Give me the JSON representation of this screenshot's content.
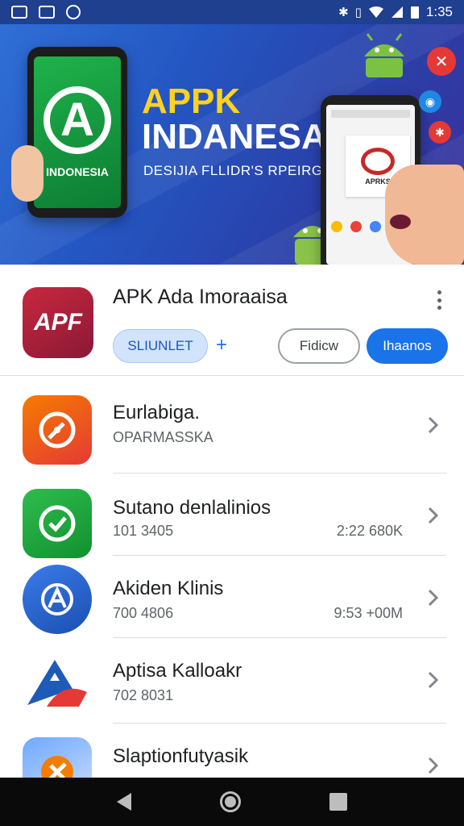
{
  "status_bar": {
    "time": "1:35",
    "left_icons": [
      "image-icon",
      "chart-icon",
      "circle-icon"
    ],
    "right_icons": [
      "bluetooth-icon",
      "vibrate-icon",
      "wifi-icon",
      "signal-icon",
      "battery-icon"
    ]
  },
  "banner": {
    "title_line1": "APPK",
    "title_line2": "INDANESA",
    "subtitle": "DESIJIA FLLIDR'S RPEIRG",
    "phone_left_label": "INDONESIA",
    "phone_right_label": "APRKS",
    "colors": {
      "title_yellow": "#ffd21f",
      "bg": "#2456c2"
    }
  },
  "app_header": {
    "icon_text": "APF",
    "title": "APK Ada Imoraaisa",
    "chip_label": "SLIUNLET",
    "plus_label": "+",
    "outline_button": "Fidicw",
    "filled_button": "Ihaanos"
  },
  "list": [
    {
      "name": "Eurlabiga.",
      "sub": "OPARMASSKA",
      "meta": "",
      "icon": "compass-icon",
      "color": "#f4511e"
    },
    {
      "name": "Sutano denlalinios",
      "sub": "101 3405",
      "meta": "2:22 680K",
      "icon": "check-icon",
      "color": "#1faa3e"
    },
    {
      "name": "Akiden Klinis",
      "sub": "700 4806",
      "meta": "9:53 +00M",
      "icon": "apps-icon",
      "color": "#2563c9"
    },
    {
      "name": "Aptisa Kalloakr",
      "sub": "702 8031",
      "meta": "",
      "icon": "mountain-icon",
      "color": "#1e5bb8"
    },
    {
      "name": "Slaptionfutyasik",
      "sub": "",
      "meta": "",
      "icon": "tools-icon",
      "color": "#f57c00"
    }
  ],
  "nav": {
    "back": "back-icon",
    "home": "home-icon",
    "recent": "recent-apps-icon"
  }
}
